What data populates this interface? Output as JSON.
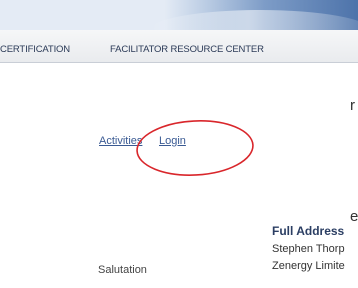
{
  "nav": {
    "items": [
      {
        "label": "CERTIFICATION"
      },
      {
        "label": "FACILITATOR RESOURCE CENTER"
      }
    ]
  },
  "edge_text": {
    "right_top": "r",
    "right_bottom": "e"
  },
  "links": {
    "activities": "Activities",
    "login": "Login"
  },
  "annotation": {
    "circle_color": "#d9262b"
  },
  "form": {
    "salutation_label": "Salutation"
  },
  "address": {
    "heading": "Full Address",
    "lines": [
      "Stephen Thorp",
      "Zenergy Limite"
    ]
  }
}
